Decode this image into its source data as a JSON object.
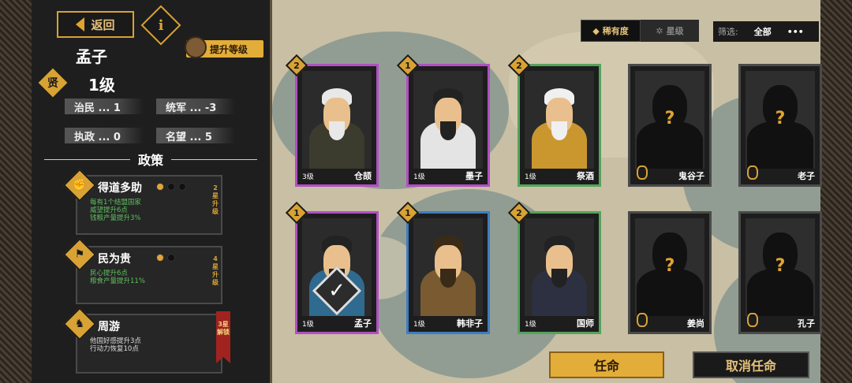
{
  "header": {
    "back_label": "返回",
    "info_label": "i",
    "upgrade_label": "提升等级"
  },
  "hero": {
    "name": "孟子",
    "rank": "贤",
    "level": "1级"
  },
  "stats": [
    {
      "label": "治民 ... 1"
    },
    {
      "label": "统军 ... -3"
    },
    {
      "label": "执政 ... 0"
    },
    {
      "label": "名望 ... 5"
    }
  ],
  "policies_title": "政策",
  "policies": [
    {
      "name": "得道多助",
      "lines": [
        "每有1个结盟国家",
        "威望提升6点",
        "钱粮产量提升3%"
      ],
      "side": "2星升级",
      "stars": 1
    },
    {
      "name": "民为贵",
      "lines": [
        "民心提升6点",
        "粮食产量提升11%"
      ],
      "side": "4星升级",
      "stars": 1
    },
    {
      "name": "周游",
      "lines": [
        "他国好感提升3点",
        "行动力恢复10点"
      ],
      "side": "3星解锁"
    }
  ],
  "tabs": [
    {
      "label": "稀有度"
    },
    {
      "label": "星级"
    }
  ],
  "filter": {
    "label": "筛选:",
    "value": "全部",
    "more": "•••"
  },
  "cards": [
    {
      "name": "仓颉",
      "level": "3级",
      "badge": "2",
      "border": "#b14fc2",
      "locked": false,
      "robe": "#3b3b2e",
      "hair": "#e8e8e8",
      "beard": "#e8e8e8"
    },
    {
      "name": "墨子",
      "level": "1级",
      "badge": "1",
      "border": "#b14fc2",
      "locked": false,
      "robe": "#e4e4e4",
      "hair": "#222",
      "beard": "#222"
    },
    {
      "name": "祭酒",
      "level": "1级",
      "badge": "2",
      "border": "#55a35a",
      "locked": false,
      "robe": "#c9972e",
      "hair": "#f0f0f0",
      "beard": "#f0f0f0"
    },
    {
      "name": "鬼谷子",
      "level": "",
      "badge": "",
      "border": "#4a4a4a",
      "locked": true
    },
    {
      "name": "老子",
      "level": "",
      "badge": "",
      "border": "#4a4a4a",
      "locked": true
    },
    {
      "name": "孟子",
      "level": "1级",
      "badge": "1",
      "border": "#b14fc2",
      "locked": false,
      "robe": "#2f6a8f",
      "hair": "#222",
      "beard": "#222",
      "selected": true
    },
    {
      "name": "韩非子",
      "level": "1级",
      "badge": "1",
      "border": "#3f7cc0",
      "locked": false,
      "robe": "#7a5a30",
      "hair": "#3a2a18",
      "beard": "#3a2a18"
    },
    {
      "name": "国师",
      "level": "1级",
      "badge": "2",
      "border": "#55a35a",
      "locked": false,
      "robe": "#2c3040",
      "hair": "#222",
      "beard": "#222"
    },
    {
      "name": "姜尚",
      "level": "",
      "badge": "",
      "border": "#4a4a4a",
      "locked": true
    },
    {
      "name": "孔子",
      "level": "",
      "badge": "",
      "border": "#4a4a4a",
      "locked": true
    }
  ],
  "locked_mark": "?",
  "check_mark": "✓",
  "actions": {
    "appoint": "任命",
    "cancel": "取消任命"
  }
}
